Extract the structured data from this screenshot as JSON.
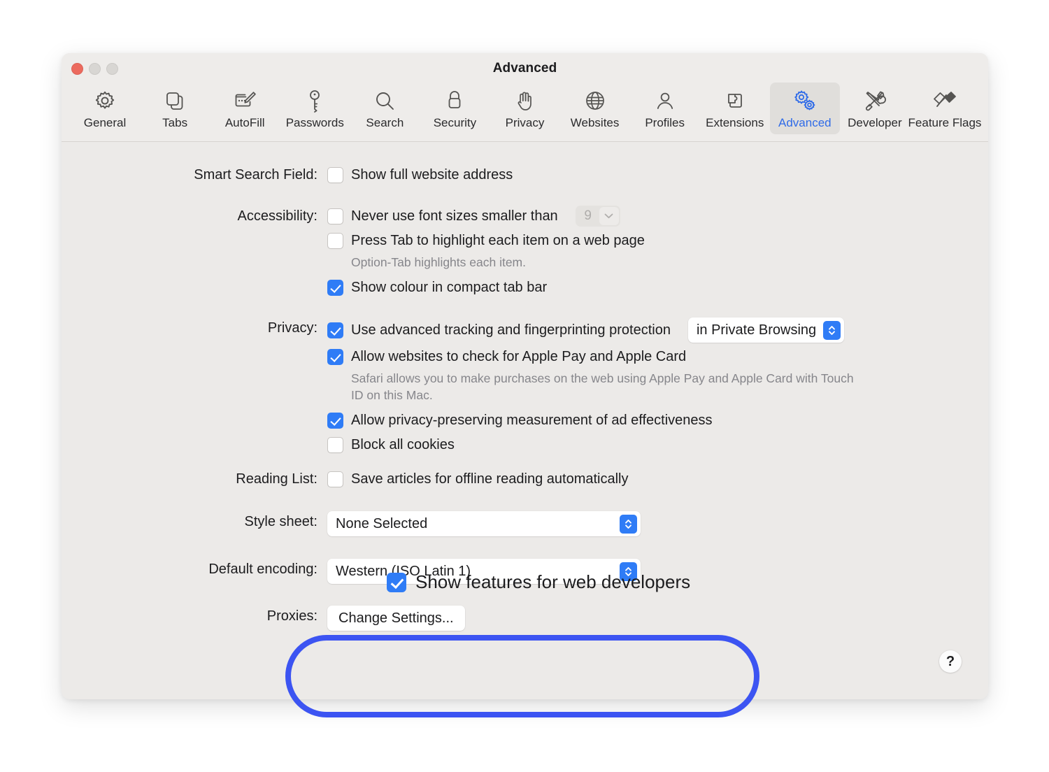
{
  "window": {
    "title": "Advanced",
    "traffic_lights": [
      "close",
      "minimize",
      "maximize"
    ]
  },
  "toolbar": {
    "tabs": [
      {
        "label": "General",
        "icon": "gear-icon",
        "selected": false
      },
      {
        "label": "Tabs",
        "icon": "tabs-icon",
        "selected": false
      },
      {
        "label": "AutoFill",
        "icon": "autofill-icon",
        "selected": false
      },
      {
        "label": "Passwords",
        "icon": "key-icon",
        "selected": false
      },
      {
        "label": "Search",
        "icon": "search-icon",
        "selected": false
      },
      {
        "label": "Security",
        "icon": "lock-icon",
        "selected": false
      },
      {
        "label": "Privacy",
        "icon": "hand-icon",
        "selected": false
      },
      {
        "label": "Websites",
        "icon": "globe-icon",
        "selected": false
      },
      {
        "label": "Profiles",
        "icon": "person-icon",
        "selected": false
      },
      {
        "label": "Extensions",
        "icon": "puzzle-icon",
        "selected": false
      },
      {
        "label": "Advanced",
        "icon": "gears-icon",
        "selected": true
      },
      {
        "label": "Developer",
        "icon": "tools-icon",
        "selected": false
      },
      {
        "label": "Feature Flags",
        "icon": "flags-icon",
        "selected": false
      }
    ]
  },
  "settings": {
    "smart_search_field": {
      "label": "Smart Search Field:",
      "show_full_address": {
        "label": "Show full website address",
        "checked": false
      }
    },
    "accessibility": {
      "label": "Accessibility:",
      "never_font_smaller": {
        "label": "Never use font sizes smaller than",
        "checked": false
      },
      "font_size_value": "9",
      "press_tab": {
        "label": "Press Tab to highlight each item on a web page",
        "checked": false
      },
      "press_tab_hint": "Option-Tab highlights each item.",
      "show_colour_tab_bar": {
        "label": "Show colour in compact tab bar",
        "checked": true
      }
    },
    "privacy": {
      "label": "Privacy:",
      "advanced_tracking": {
        "label": "Use advanced tracking and fingerprinting protection",
        "checked": true
      },
      "advanced_tracking_scope": "in Private Browsing",
      "apple_pay": {
        "label": "Allow websites to check for Apple Pay and Apple Card",
        "checked": true
      },
      "apple_pay_hint": "Safari allows you to make purchases on the web using Apple Pay and Apple Card with Touch ID on this Mac.",
      "ad_measurement": {
        "label": "Allow privacy-preserving measurement of ad effectiveness",
        "checked": true
      },
      "block_cookies": {
        "label": "Block all cookies",
        "checked": false
      }
    },
    "reading_list": {
      "label": "Reading List:",
      "save_offline": {
        "label": "Save articles for offline reading automatically",
        "checked": false
      }
    },
    "style_sheet": {
      "label": "Style sheet:",
      "value": "None Selected"
    },
    "default_encoding": {
      "label": "Default encoding:",
      "value": "Western (ISO Latin 1)"
    },
    "proxies": {
      "label": "Proxies:",
      "button": "Change Settings..."
    },
    "web_developers": {
      "label": "Show features for web developers",
      "checked": true
    }
  },
  "help_button": {
    "glyph": "?"
  },
  "annotation": {
    "shape": "ellipse",
    "color": "#3C54F2",
    "target": "Show features for web developers"
  }
}
